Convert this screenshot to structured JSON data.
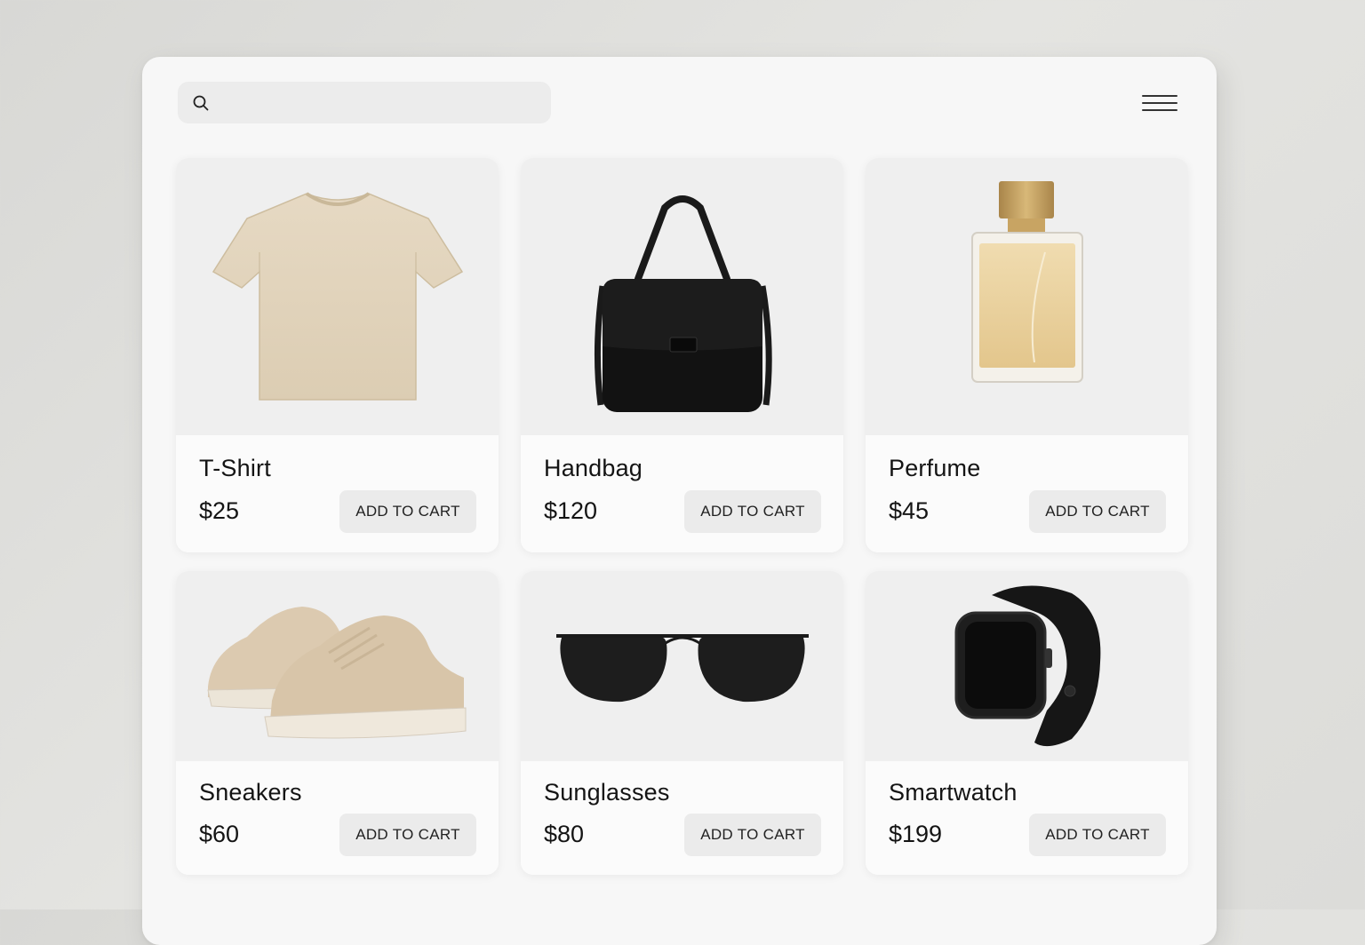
{
  "search": {
    "value": "",
    "placeholder": ""
  },
  "icons": {
    "search": "search-icon",
    "menu": "hamburger-menu-icon"
  },
  "products": [
    {
      "name": "T-Shirt",
      "price": "$25",
      "button": "ADD TO CART",
      "image": "beige-tshirt"
    },
    {
      "name": "Handbag",
      "price": "$120",
      "button": "ADD TO CART",
      "image": "black-handbag"
    },
    {
      "name": "Perfume",
      "price": "$45",
      "button": "ADD TO CART",
      "image": "perfume-bottle"
    },
    {
      "name": "Sneakers",
      "price": "$60",
      "button": "ADD TO CART",
      "image": "beige-sneakers"
    },
    {
      "name": "Sunglasses",
      "price": "$80",
      "button": "ADD TO CART",
      "image": "black-sunglasses"
    },
    {
      "name": "Smartwatch",
      "price": "$199",
      "button": "ADD TO CART",
      "image": "black-smartwatch"
    }
  ],
  "colors": {
    "background": "#dcdcd9",
    "panel": "#f7f7f7",
    "card": "#fafafa",
    "button": "#ebebeb",
    "text": "#141414"
  }
}
